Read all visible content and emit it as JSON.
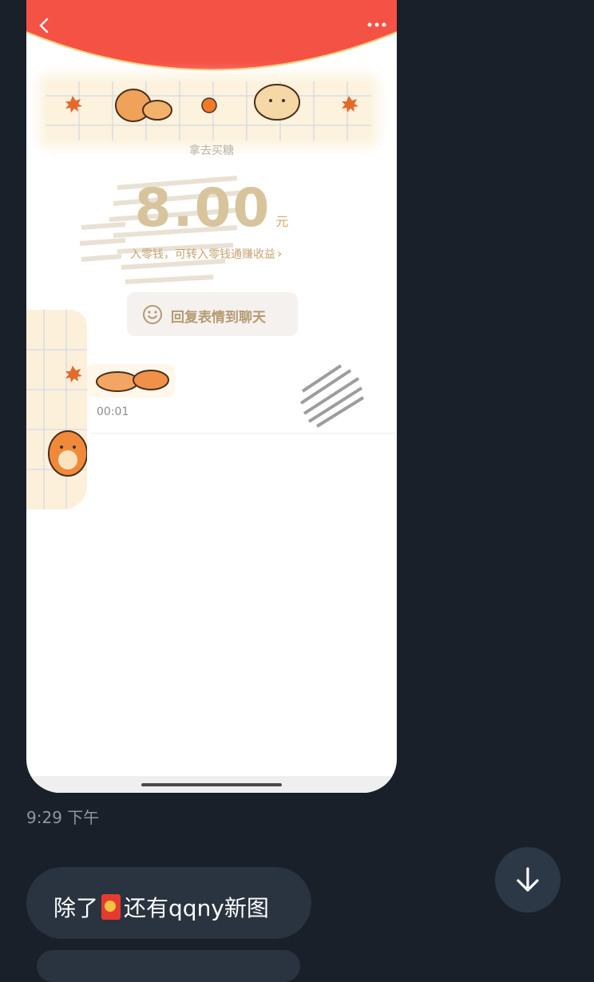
{
  "screenshot": {
    "header_color": "#f55246",
    "banner_title": "拿去买糖",
    "amount": "8.00",
    "amount_unit": "元",
    "note": "入零钱，可转入零钱通赚收益",
    "note_chevron": "›",
    "reply_button_label": "回复表情到聊天",
    "video_time": "00:01"
  },
  "chat": {
    "message_time": "9:29 下午",
    "bubble_text_before": "除了",
    "bubble_icon": "red-envelope-icon",
    "bubble_text_after": "还有qqny新图"
  },
  "colors": {
    "background": "#19202a",
    "bubble": "#2a3340",
    "scroll_button": "#2c3846",
    "gold": "#d1ad6b"
  }
}
